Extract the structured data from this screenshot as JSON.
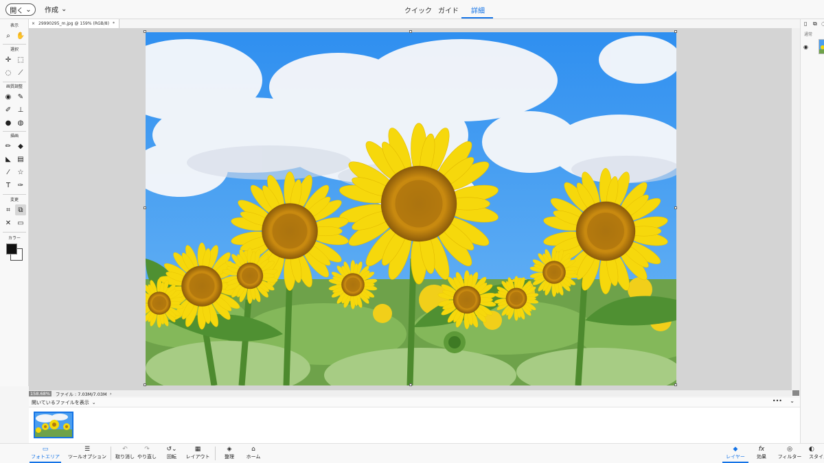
{
  "topbar": {
    "open_label": "開く",
    "create_label": "作成",
    "modes": [
      "クイック",
      "ガイド",
      "詳細"
    ],
    "active_mode": "詳細"
  },
  "toolbar": {
    "sections": {
      "view": "表示",
      "select": "選択",
      "enhance": "画質調整",
      "draw": "描画",
      "modify": "変更",
      "color": "カラー"
    },
    "colors": {
      "foreground": "#111111",
      "background": "#ffffff"
    }
  },
  "document": {
    "tab_title": "29990295_m.jpg @ 159% (RGB/8)",
    "modified_marker": "*",
    "close_glyph": "×"
  },
  "status": {
    "zoom": "158.68%",
    "file_info": "ファイル : 7.03M/7.03M"
  },
  "bin": {
    "label": "開いているファイルを表示",
    "more": "•••"
  },
  "bottombar": {
    "buttons": [
      "フォトエリア",
      "ツールオプション",
      "取り消し",
      "やり直し",
      "回転",
      "レイアウト",
      "整理",
      "ホーム",
      "レイヤー",
      "効果",
      "フィルター",
      "スタイル"
    ]
  },
  "rightpanel": {
    "blend_mode": "通常"
  },
  "theme": {
    "accent": "#1473e6",
    "sky": "#4a9ef0",
    "petal": "#f5d90a",
    "leaf": "#5e9a3e"
  }
}
